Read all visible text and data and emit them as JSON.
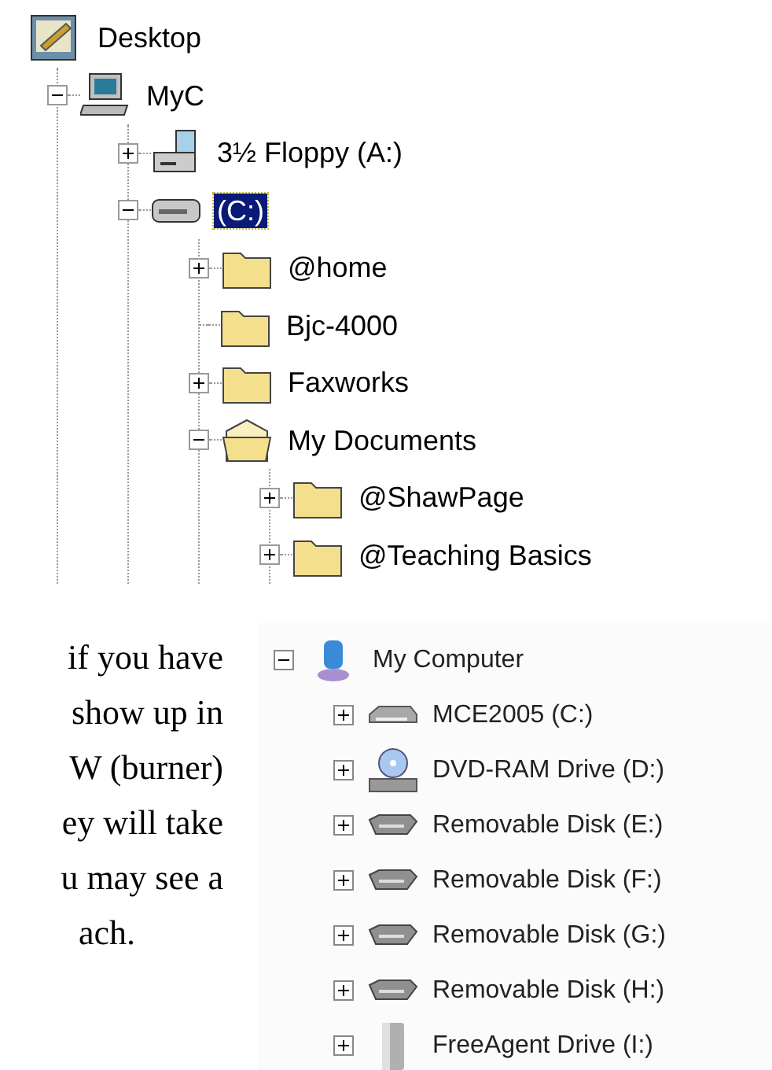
{
  "explorer_tree": {
    "items": [
      {
        "label": "Desktop",
        "kind": "desktop",
        "selected": false,
        "children": [
          {
            "label": "MyC",
            "kind": "computer",
            "expanded": true,
            "selected": false,
            "children": [
              {
                "label": "3½ Floppy (A:)",
                "kind": "floppy",
                "expanded": false,
                "selected": false
              },
              {
                "label": "(C:)",
                "kind": "drive",
                "expanded": true,
                "selected": true,
                "children": [
                  {
                    "label": "@home",
                    "kind": "folder",
                    "expanded": false,
                    "selected": false
                  },
                  {
                    "label": "Bjc-4000",
                    "kind": "folder",
                    "selected": false
                  },
                  {
                    "label": "Faxworks",
                    "kind": "folder",
                    "expanded": false,
                    "selected": false
                  },
                  {
                    "label": "My Documents",
                    "kind": "open-folder",
                    "expanded": true,
                    "selected": false,
                    "children": [
                      {
                        "label": "@ShawPage",
                        "kind": "folder",
                        "expanded": false,
                        "selected": false
                      },
                      {
                        "label": "@Teaching Basics",
                        "kind": "folder",
                        "expanded": false,
                        "selected": false
                      }
                    ]
                  }
                ]
              }
            ]
          }
        ]
      }
    ]
  },
  "article_text": {
    "lines": [
      "if you have",
      "show up in",
      "W (burner)",
      "ey will take",
      "u may see a",
      "ach."
    ]
  },
  "drive_tree": {
    "items": [
      {
        "label": "My Computer",
        "kind": "computer-blue",
        "expanded": true,
        "children": [
          {
            "label": "MCE2005 (C:)",
            "kind": "hdd",
            "expanded": false
          },
          {
            "label": "DVD-RAM Drive (D:)",
            "kind": "dvd",
            "expanded": false
          },
          {
            "label": "Removable Disk (E:)",
            "kind": "removable",
            "expanded": false
          },
          {
            "label": "Removable Disk (F:)",
            "kind": "removable",
            "expanded": false
          },
          {
            "label": "Removable Disk (G:)",
            "kind": "removable",
            "expanded": false
          },
          {
            "label": "Removable Disk (H:)",
            "kind": "removable",
            "expanded": false
          },
          {
            "label": "FreeAgent Drive (I:)",
            "kind": "external",
            "expanded": false
          }
        ]
      }
    ]
  }
}
